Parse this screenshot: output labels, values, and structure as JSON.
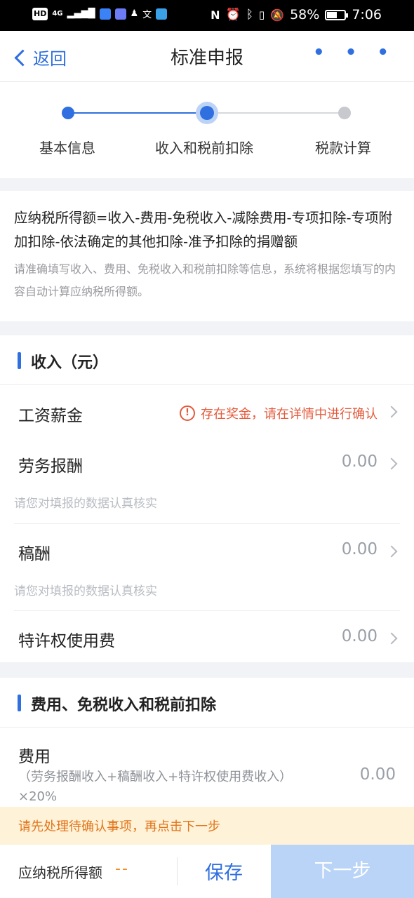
{
  "status_bar": {
    "hd": "HD",
    "net": "4G",
    "battery_pct": "58%",
    "battery_level": 0.58,
    "time": "7:06"
  },
  "nav": {
    "back_label": "返回",
    "title": "标准申报",
    "more": "• • •"
  },
  "steps": [
    {
      "label": "基本信息",
      "state": "done"
    },
    {
      "label": "收入和税前扣除",
      "state": "current"
    },
    {
      "label": "税款计算",
      "state": "pending"
    }
  ],
  "formula": {
    "text": "应纳税所得额=收入-费用-免税收入-减除费用-专项扣除-专项附加扣除-依法确定的其他扣除-准予扣除的捐赠额",
    "note": "请准确填写收入、费用、免税收入和税前扣除等信息，系统将根据您填写的内容自动计算应纳税所得额。"
  },
  "income_section": {
    "title": "收入（元）",
    "rows": [
      {
        "label": "工资薪金",
        "warning": "存在奖金，请在详情中进行确认",
        "warning_icon": "!"
      },
      {
        "label": "劳务报酬",
        "value": "0.00",
        "sub": "请您对填报的数据认真核实"
      },
      {
        "label": "稿酬",
        "value": "0.00",
        "sub": "请您对填报的数据认真核实"
      },
      {
        "label": "特许权使用费",
        "value": "0.00"
      }
    ]
  },
  "deduction_section": {
    "title": "费用、免税收入和税前扣除",
    "expense": {
      "label": "费用",
      "formula_line1": "（劳务报酬收入+稿酬收入+特许权使用费收入）",
      "formula_line2": "×20%",
      "value": "0.00"
    }
  },
  "banner": "请先处理待确认事项，再点击下一步",
  "bottom": {
    "tax_label": "应纳税所得额",
    "tax_value": "--",
    "save_label": "保存",
    "next_label": "下一步"
  },
  "colors": {
    "accent": "#2f6fe0",
    "warning": "#e45a3c",
    "banner_bg": "#fef3d8",
    "banner_text": "#e2741b",
    "next_disabled": "#b9d4f7"
  }
}
